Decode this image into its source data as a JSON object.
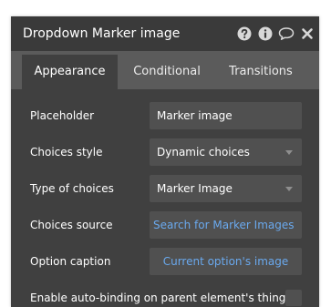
{
  "window": {
    "title": "Dropdown Marker image",
    "icons": [
      "help-icon",
      "info-icon",
      "comment-icon",
      "close-icon"
    ]
  },
  "tabs": [
    {
      "label": "Appearance",
      "active": true
    },
    {
      "label": "Conditional",
      "active": false
    },
    {
      "label": "Transitions",
      "active": false
    }
  ],
  "fields": {
    "placeholder": {
      "label": "Placeholder",
      "value": "Marker image"
    },
    "choices_style": {
      "label": "Choices style",
      "value": "Dynamic choices"
    },
    "type_of_choices": {
      "label": "Type of choices",
      "value": "Marker Image"
    },
    "choices_source": {
      "label": "Choices source",
      "value": "Search for Marker Images"
    },
    "option_caption": {
      "label": "Option caption",
      "value": "Current option's image"
    },
    "auto_binding": {
      "label": "Enable auto-binding on parent element's thing",
      "checked": false
    }
  },
  "colors": {
    "header_bg": "#3a3a3a",
    "tab_bar_bg": "#5b5b5b",
    "content_bg": "#404040",
    "field_bg": "#505050",
    "link": "#6aa9ee"
  }
}
